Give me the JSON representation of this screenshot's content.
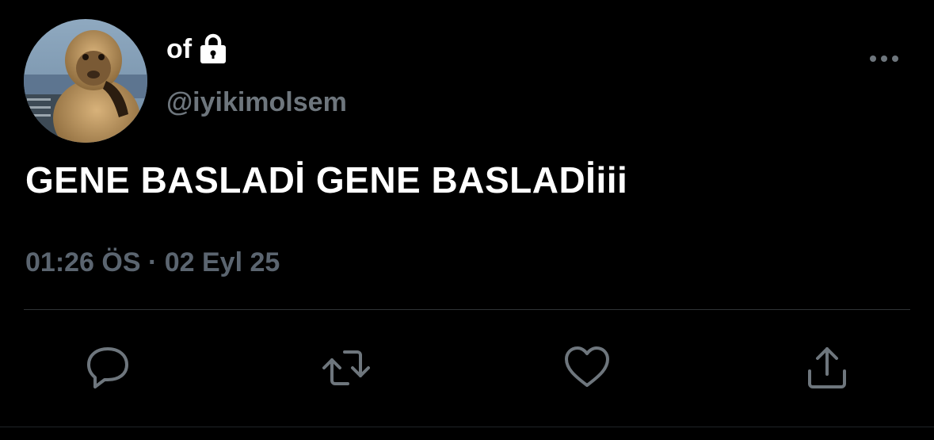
{
  "tweet": {
    "display_name": "of",
    "handle": "@iyikimolsem",
    "text": "GENE BASLADİ GENE BASLADİiii",
    "timestamp": "01:26 ÖS · 02 Eyl 25",
    "locked": true,
    "icons": {
      "lock": "lock-icon",
      "more": "more-horizontal-icon",
      "reply": "reply-icon",
      "retweet": "retweet-icon",
      "like": "heart-icon",
      "share": "share-icon"
    }
  },
  "colors": {
    "background": "#000000",
    "primary_text": "#ffffff",
    "secondary_text": "#6e767d",
    "icon": "#6e767d",
    "divider": "#2f3336"
  }
}
